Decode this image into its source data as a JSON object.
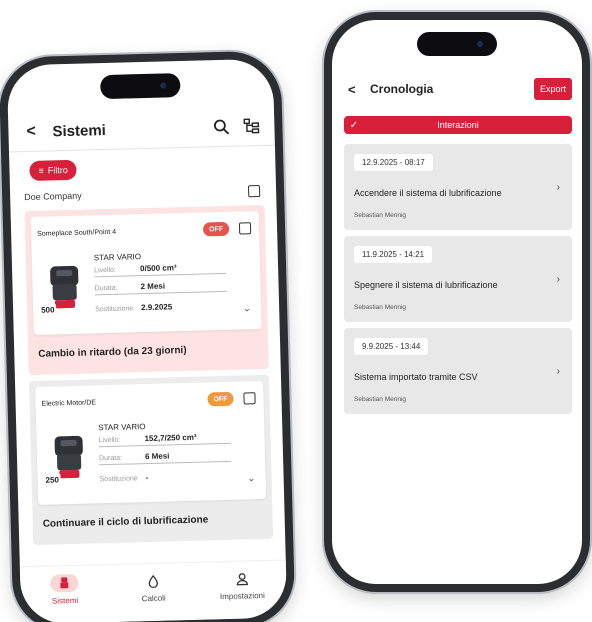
{
  "left": {
    "header": {
      "title": "Sistemi",
      "back": "<"
    },
    "filter_label": "Filtro",
    "company": "Doe Company",
    "cards": [
      {
        "location": "Someplace South/Point 4",
        "status": "OFF",
        "status_color": "#e9514d",
        "product": "STAR VARIO",
        "level_label": "Livello:",
        "level_value": "0/500 cm³",
        "duration_label": "Durata:",
        "duration_value": "2 Mesi",
        "replacement_label": "Sostituzione",
        "replacement_value": "2.9.2025",
        "volume": "500",
        "message": "Cambio in ritardo (da  23 giorni)"
      },
      {
        "location": "Electric Motor/DE",
        "status": "OFF",
        "status_color": "#f19a33",
        "product": "STAR VARIO",
        "level_label": "Livello:",
        "level_value": "152,7/250 cm³",
        "duration_label": "Durata:",
        "duration_value": "6 Mesi",
        "replacement_label": "Sostituzione",
        "replacement_value": "-",
        "volume": "250",
        "message": "Continuare il ciclo di lubrificazione"
      }
    ],
    "tabs": [
      {
        "label": "Sistemi",
        "icon": "lubricator-icon",
        "active": true
      },
      {
        "label": "Calcoli",
        "icon": "drop-icon",
        "active": false
      },
      {
        "label": "Impostazioni",
        "icon": "user-icon",
        "active": false
      }
    ]
  },
  "right": {
    "header": {
      "title": "Cronologia",
      "back": "<",
      "export_label": "Export"
    },
    "filter_label": "Interazioni",
    "entries": [
      {
        "date": "12.9.2025 - 08:17",
        "action": "Accendere il sistema di lubrificazione",
        "user": "Sebastian Mennig"
      },
      {
        "date": "11.9.2025 - 14:21",
        "action": "Spegnere il sistema di lubrificazione",
        "user": "Sebastian Mennig"
      },
      {
        "date": "9.9.2025 - 13:44",
        "action": "Sistema importato tramite CSV",
        "user": "Sebastian Mennig"
      }
    ]
  },
  "colors": {
    "accent": "#d8203a",
    "overdue_bg": "#fde3e2",
    "card_bg": "#ececec"
  }
}
